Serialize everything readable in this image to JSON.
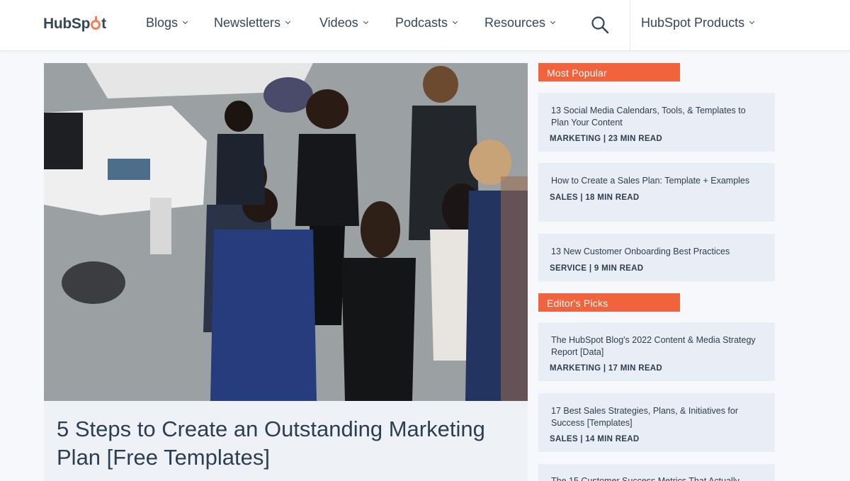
{
  "header": {
    "logo_text_a": "HubSp",
    "logo_text_b": "t",
    "nav": [
      {
        "label": "Blogs"
      },
      {
        "label": "Newsletters"
      },
      {
        "label": "Videos"
      },
      {
        "label": "Podcasts"
      },
      {
        "label": "Resources"
      }
    ],
    "products_label": "HubSpot Products"
  },
  "hero": {
    "title": "5 Steps to Create an Outstanding Marketing Plan [Free Templates]"
  },
  "sidebar": {
    "most_popular_label": "Most Popular",
    "editors_picks_label": "Editor's Picks",
    "most_popular": [
      {
        "title": "13 Social Media Calendars, Tools, & Templates to Plan Your Content",
        "category": "MARKETING",
        "read_time": "23 MIN READ"
      },
      {
        "title": "How to Create a Sales Plan: Template + Examples",
        "category": "SALES",
        "read_time": "18 MIN READ"
      },
      {
        "title": "13 New Customer Onboarding Best Practices",
        "category": "SERVICE",
        "read_time": "9 MIN READ"
      }
    ],
    "editors_picks": [
      {
        "title": "The HubSpot Blog's 2022 Content & Media Strategy Report [Data]",
        "category": "MARKETING",
        "read_time": "17 MIN READ"
      },
      {
        "title": "17 Best Sales Strategies, Plans, & Initiatives for Success [Templates]",
        "category": "SALES",
        "read_time": "14 MIN READ"
      },
      {
        "title": "The 15 Customer Success Metrics That Actually",
        "category": "",
        "read_time": ""
      }
    ],
    "separator": " | "
  },
  "colors": {
    "accent": "#f0633c",
    "logo_orange": "#ff7a59",
    "text": "#2d3e50",
    "card_bg": "#e9edf5"
  }
}
